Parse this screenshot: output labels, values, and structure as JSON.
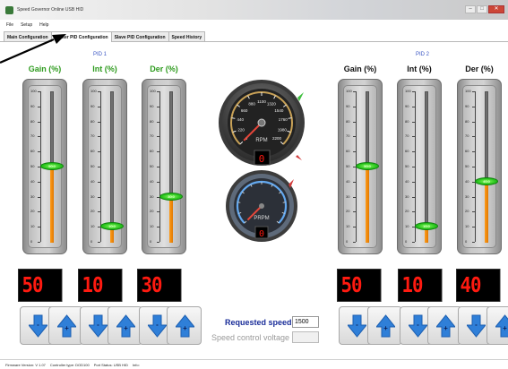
{
  "window": {
    "title": "Speed Governor Online USB HID"
  },
  "menu": [
    "File",
    "Setup",
    "Help"
  ],
  "tabs": [
    "Main Configuration",
    "Master PID Configuration",
    "Slave PID Configuration",
    "Speed History"
  ],
  "active_tab": "Master PID Configuration",
  "pid1": {
    "title": "PID 1",
    "sliders": [
      {
        "label": "Gain (%)",
        "value": 50,
        "thumb_text": "50.0",
        "display": "50",
        "label_color": "#2e9b1e"
      },
      {
        "label": "Int (%)",
        "value": 10,
        "thumb_text": "10.0",
        "display": "10",
        "label_color": "#2e9b1e"
      },
      {
        "label": "Der (%)",
        "value": 30,
        "thumb_text": "30.0",
        "display": "30",
        "label_color": "#2e9b1e"
      }
    ]
  },
  "pid2": {
    "title": "PID 2",
    "sliders": [
      {
        "label": "Gain (%)",
        "value": 50,
        "thumb_text": "50.0",
        "display": "50",
        "label_color": "#111111"
      },
      {
        "label": "Int (%)",
        "value": 10,
        "thumb_text": "10.0",
        "display": "10",
        "label_color": "#111111"
      },
      {
        "label": "Der (%)",
        "value": 40,
        "thumb_text": "40.0",
        "display": "40",
        "label_color": "#111111"
      }
    ]
  },
  "scale_labels": [
    "100",
    "90",
    "80",
    "70",
    "60",
    "50",
    "40",
    "30",
    "20",
    "10",
    "0"
  ],
  "buttons": {
    "minus": "-",
    "plus": "+"
  },
  "gauge_rpm": {
    "label": "RPM",
    "ticks": [
      "0",
      "220",
      "440",
      "660",
      "880",
      "1100",
      "1320",
      "1540",
      "1760",
      "1980",
      "2200"
    ],
    "value": 0
  },
  "gauge_prpm": {
    "label": "PRPM",
    "value": 0
  },
  "requested_speed": {
    "label": "Requested speed",
    "value": "1500"
  },
  "speed_control_voltage": {
    "label": "Speed control voltage",
    "value": ""
  },
  "status": {
    "firmware": "Firmware Version:  V 1.07",
    "controller": "Controller type:  DOD100",
    "port": "Port Status:  USB HID",
    "info": "Info:"
  },
  "colors": {
    "accent_blue": "#2f7fd8",
    "led_red": "#ff1a10",
    "fill_orange": "#f08a0c",
    "thumb_green": "#27c21c"
  }
}
